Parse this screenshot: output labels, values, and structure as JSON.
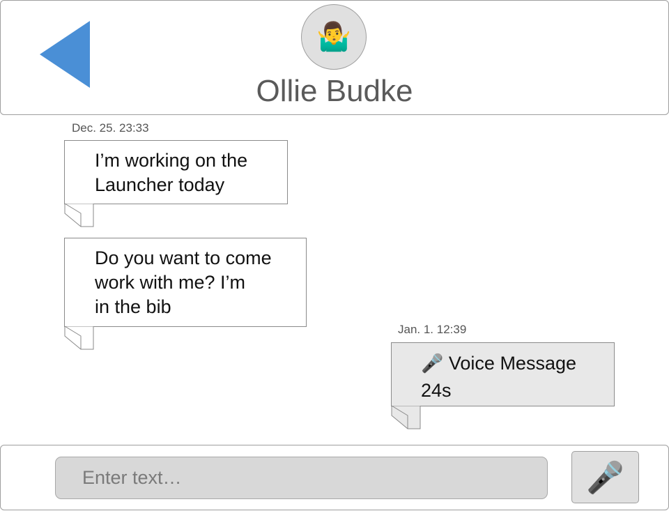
{
  "header": {
    "back_icon": "back-triangle-icon",
    "avatar_emoji": "🤷‍♂️",
    "contact_name": "Ollie Budke",
    "accent_color": "#4a8fd6"
  },
  "messages": [
    {
      "timestamp": "Dec. 25. 23:33"
    },
    {
      "line1": "I’m working on the",
      "line2": "Launcher today"
    },
    {
      "line1": "Do you want to come",
      "line2": "work with me? I’m",
      "line3": "in the bib"
    },
    {
      "timestamp": "Jan. 1. 12:39"
    },
    {
      "icon": "🎤",
      "label": "Voice Message",
      "duration": "24s"
    }
  ],
  "composer": {
    "placeholder": "Enter text…",
    "mic_icon": "🎤"
  }
}
